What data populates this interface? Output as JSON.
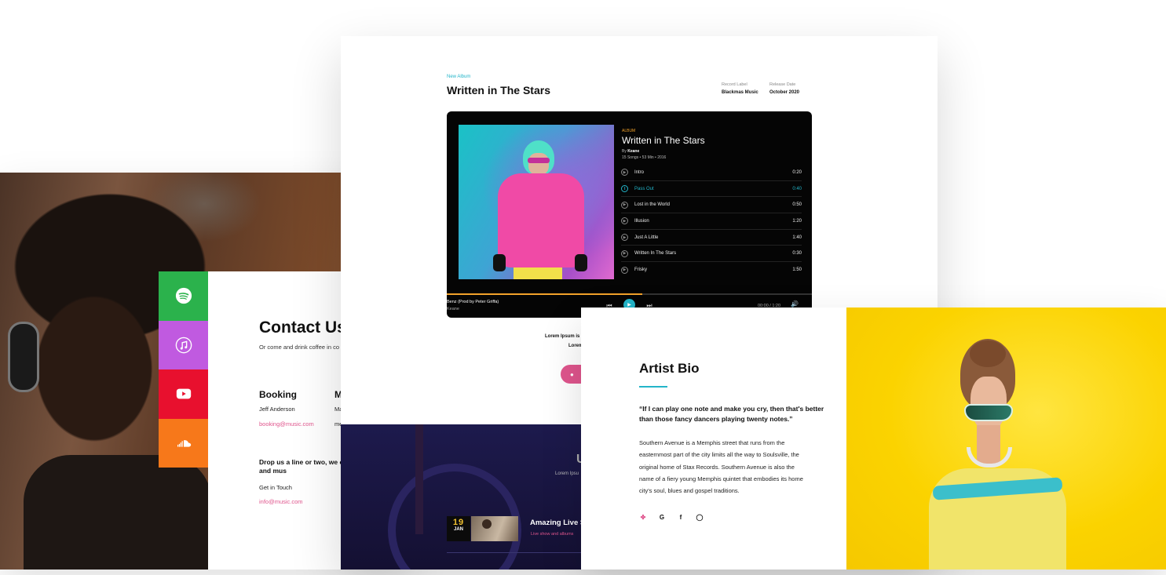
{
  "contact": {
    "title": "Contact Us",
    "subtitle": "Or come and drink coffee in co",
    "booking_title": "Booking",
    "booking_name": "Jeff Anderson",
    "booking_email": "booking@music.com",
    "second_title": "M",
    "second_name": "Ma",
    "second_email": "me",
    "drop_line": "Drop us a line or two, we creative minds and mus",
    "get_in_touch": "Get in Touch",
    "info_email": "info@music.com",
    "social": [
      {
        "name": "spotify",
        "color": "#2bb24c",
        "icon": "spotify-icon"
      },
      {
        "name": "apple-music",
        "color": "#c05ae0",
        "icon": "music-note-icon"
      },
      {
        "name": "youtube",
        "color": "#e8102e",
        "icon": "youtube-icon"
      },
      {
        "name": "soundcloud",
        "color": "#f7781a",
        "icon": "soundcloud-icon"
      }
    ]
  },
  "album": {
    "kicker": "New Album",
    "title": "Written in The Stars",
    "record_label_label": "Record Label",
    "record_label_value": "Blackmas Music",
    "release_date_label": "Release Date",
    "release_date_value": "October 2020",
    "player": {
      "kicker": "ALBUM",
      "title": "Written in The Stars",
      "by_prefix": "By",
      "artist": "Keane",
      "info": "15 Songs • 53 Min • 2016",
      "tracks": [
        {
          "name": "Intro",
          "duration": "0:20",
          "active": false
        },
        {
          "name": "Pass Out",
          "duration": "0:40",
          "active": true
        },
        {
          "name": "Lost in the World",
          "duration": "0:50",
          "active": false
        },
        {
          "name": "Illusion",
          "duration": "1:20",
          "active": false
        },
        {
          "name": "Just A Little",
          "duration": "1:40",
          "active": false
        },
        {
          "name": "Written In The Stars",
          "duration": "0:30",
          "active": false
        },
        {
          "name": "Frisky",
          "duration": "1:50",
          "active": false
        }
      ],
      "now_playing_title": "Benz (Prod by Peter Griffa)",
      "now_playing_artist": "Keane",
      "time_readout": "00:00 / 1:20",
      "progress": 0.535,
      "accent": "#23b5c9",
      "progress_color": "#f2a22a"
    },
    "lorem_line_1": "Lorem Ipsum is",
    "lorem_line_2": "Lorem",
    "apple_button_glyph": ""
  },
  "events": {
    "title": "U",
    "subtitle": "Lorem Ipsu",
    "event_day": "19",
    "event_month": "JAN",
    "event_title": "Amazing Live S",
    "event_sub": "Live show and albums"
  },
  "bio": {
    "title": "Artist Bio",
    "quote": "“If I can play one note and make you cry, then that's better than those fancy dancers playing twenty notes.”",
    "body": "Southern Avenue is a Memphis street that runs from the easternmost part of the city limits all the way to Soulsville, the original home of Stax Records. Southern Avenue is also the name of a fiery young Memphis quintet that embodies its home city's soul, blues and gospel traditions.",
    "social_icons": [
      "twitter-icon",
      "google-icon",
      "facebook-icon",
      "instagram-icon"
    ],
    "twitter_color": "#e0558d",
    "accent": "#23b5c9"
  }
}
